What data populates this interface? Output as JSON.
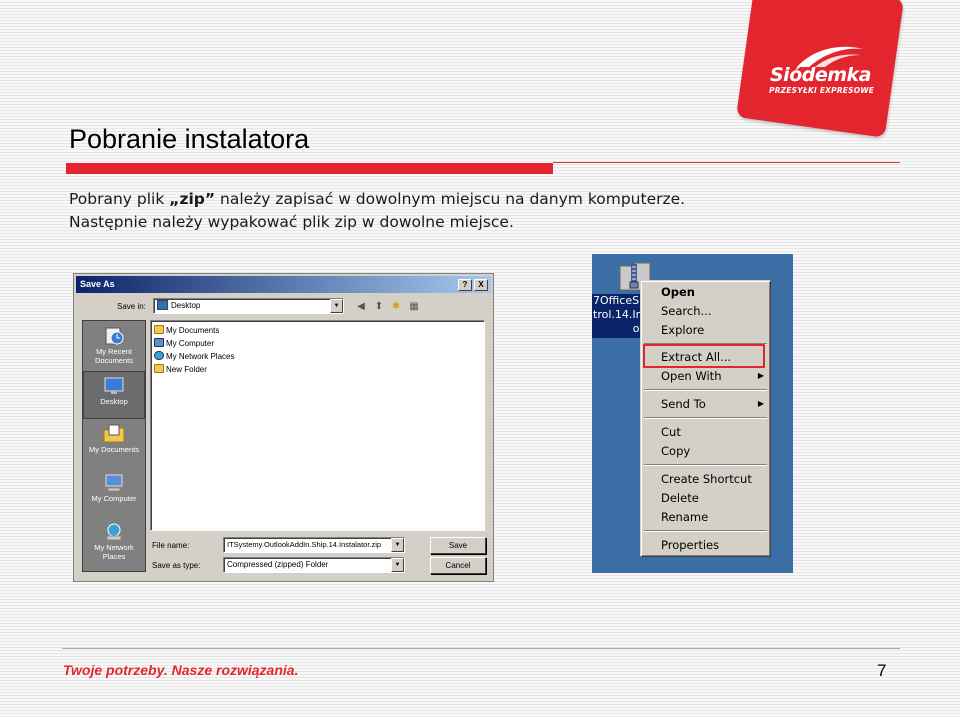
{
  "logo": {
    "brand": "Siódemka",
    "tagline": "PRZESYŁKI EXPRESOWE"
  },
  "slide": {
    "title": "Pobranie instalatora",
    "line1_prefix": "Pobrany plik ",
    "line1_bold": "„zip”",
    "line1_suffix": " należy zapisać w dowolnym miejscu na danym komputerze.",
    "line2": "Następnie należy wypakować plik zip w dowolne miejsce."
  },
  "save_dialog": {
    "title": "Save As",
    "help_btn": "?",
    "close_btn": "X",
    "save_in_label": "Save in:",
    "save_in_value": "Desktop",
    "places": [
      {
        "label": "My Recent Documents"
      },
      {
        "label": "Desktop"
      },
      {
        "label": "My Documents"
      },
      {
        "label": "My Computer"
      },
      {
        "label": "My Network Places"
      }
    ],
    "files": [
      {
        "name": "My Documents",
        "icon": "folder-docs-icon"
      },
      {
        "name": "My Computer",
        "icon": "computer-icon"
      },
      {
        "name": "My Network Places",
        "icon": "network-icon"
      },
      {
        "name": "New Folder",
        "icon": "folder-icon"
      }
    ],
    "file_name_label": "File name:",
    "file_name_value": "ITSystemy.OutlookAddIn.Ship.14.Instalator.zip",
    "save_as_type_label": "Save as type:",
    "save_as_type_value": "Compressed (zipped) Folder",
    "save_btn": "Save",
    "cancel_btn": "Cancel"
  },
  "context_menu": {
    "file_label_lines": [
      "7OfficeSl",
      "trol.14.In",
      "or"
    ],
    "items": {
      "open": "Open",
      "search": "Search...",
      "explore": "Explore",
      "extract": "Extract All...",
      "open_with": "Open With",
      "send_to": "Send To",
      "cut": "Cut",
      "copy": "Copy",
      "create_shortcut": "Create Shortcut",
      "delete": "Delete",
      "rename": "Rename",
      "properties": "Properties"
    },
    "highlight_color": "#e3262e"
  },
  "footer": {
    "tagline": "Twoje potrzeby. Nasze rozwiązania.",
    "page_number": "7"
  },
  "colors": {
    "brand_red": "#e3262e",
    "title_bar_blue": "#0a246a",
    "desktop_blue": "#3a6ea5"
  }
}
